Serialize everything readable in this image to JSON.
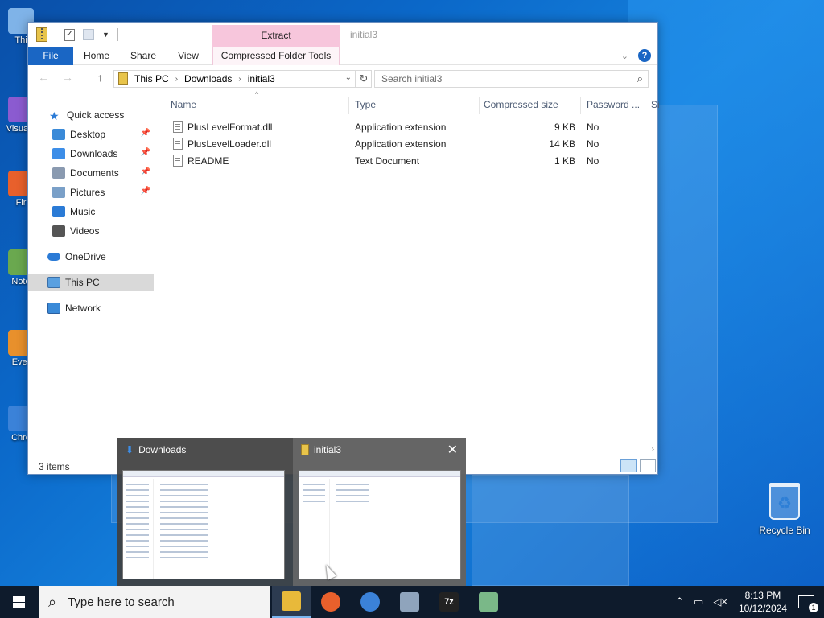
{
  "desktop": {
    "icons": [
      {
        "label": "Thi",
        "color": "#7fb3e8"
      },
      {
        "label": "Visua 2",
        "color": "#8b5bd0"
      },
      {
        "label": "Fir",
        "color": "#e8602c"
      },
      {
        "label": "Note",
        "color": "#6aa84f"
      },
      {
        "label": "Ever",
        "color": "#e8902c"
      },
      {
        "label": "Chro",
        "color": "#3b82d8"
      }
    ],
    "recycle_bin": "Recycle Bin"
  },
  "explorer": {
    "ribbon_context_tab": "Extract",
    "window_title": "initial3",
    "tabs": [
      "File",
      "Home",
      "Share",
      "View",
      "Compressed Folder Tools"
    ],
    "address": {
      "crumbs": [
        "This PC",
        "Downloads",
        "initial3"
      ]
    },
    "search_placeholder": "Search initial3",
    "nav": {
      "quick_access": "Quick access",
      "items": [
        {
          "label": "Desktop",
          "pinned": true
        },
        {
          "label": "Downloads",
          "pinned": true
        },
        {
          "label": "Documents",
          "pinned": true
        },
        {
          "label": "Pictures",
          "pinned": true
        },
        {
          "label": "Music",
          "pinned": false
        },
        {
          "label": "Videos",
          "pinned": false
        }
      ],
      "onedrive": "OneDrive",
      "this_pc": "This PC",
      "network": "Network"
    },
    "columns": [
      "Name",
      "Type",
      "Compressed size",
      "Password ...",
      "Si"
    ],
    "files": [
      {
        "name": "PlusLevelFormat.dll",
        "type": "Application extension",
        "size": "9 KB",
        "password": "No"
      },
      {
        "name": "PlusLevelLoader.dll",
        "type": "Application extension",
        "size": "14 KB",
        "password": "No"
      },
      {
        "name": "README",
        "type": "Text Document",
        "size": "1 KB",
        "password": "No"
      }
    ],
    "status": "3 items"
  },
  "thumbnails": [
    {
      "title": "Downloads"
    },
    {
      "title": "initial3"
    }
  ],
  "taskbar": {
    "search_placeholder": "Type here to search",
    "apps": [
      {
        "name": "File Explorer",
        "active": true,
        "color": "#e8b93a",
        "glyph": ""
      },
      {
        "name": "Firefox",
        "active": false,
        "color": "#e8602c",
        "glyph": ""
      },
      {
        "name": "Chrome",
        "active": false,
        "color": "#3b82d8",
        "glyph": ""
      },
      {
        "name": "App",
        "active": false,
        "color": "#8fa4bc",
        "glyph": ""
      },
      {
        "name": "7-Zip",
        "active": false,
        "color": "#222222",
        "glyph": "7z"
      },
      {
        "name": "Notepad++",
        "active": false,
        "color": "#7ab888",
        "glyph": ""
      }
    ],
    "time": "8:13 PM",
    "date": "10/12/2024",
    "notification_count": "1"
  }
}
